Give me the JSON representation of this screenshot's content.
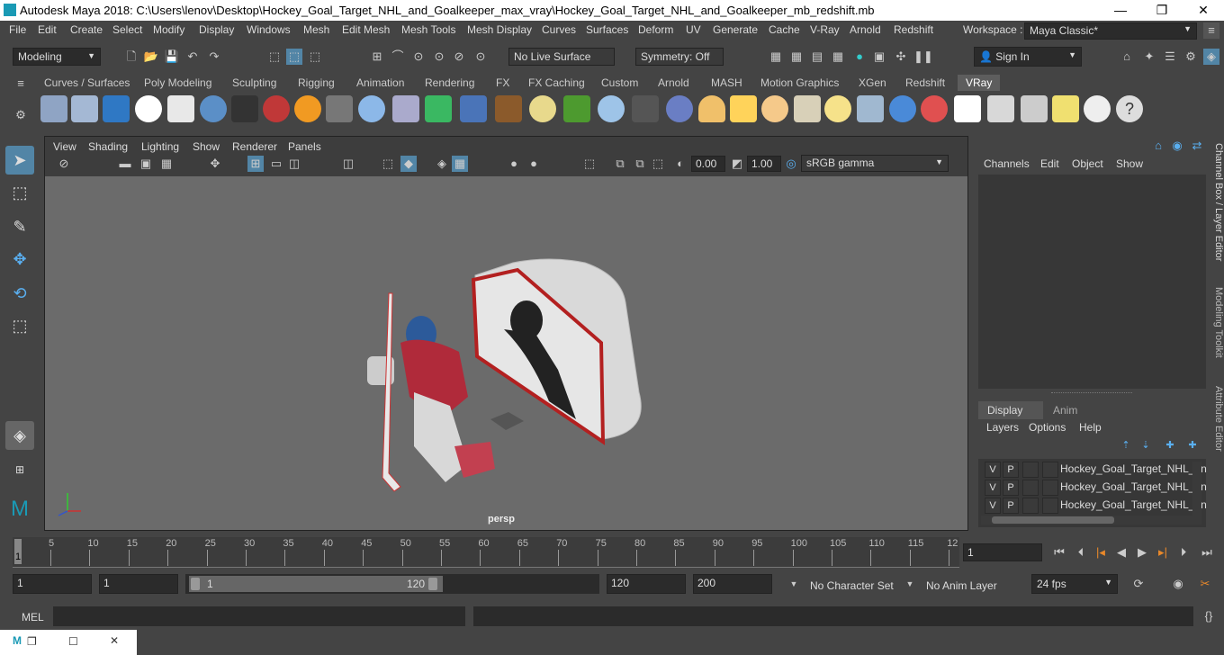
{
  "title": "Autodesk Maya 2018: C:\\Users\\lenov\\Desktop\\Hockey_Goal_Target_NHL_and_Goalkeeper_max_vray\\Hockey_Goal_Target_NHL_and_Goalkeeper_mb_redshift.mb",
  "window_controls": [
    "—",
    "❐",
    "✕"
  ],
  "menus": [
    "File",
    "Edit",
    "Create",
    "Select",
    "Modify",
    "Display",
    "Windows",
    "Mesh",
    "Edit Mesh",
    "Mesh Tools",
    "Mesh Display",
    "Curves",
    "Surfaces",
    "Deform",
    "UV",
    "Generate",
    "Cache",
    "V-Ray",
    "Arnold",
    "Redshift"
  ],
  "workspace": {
    "label": "Workspace :",
    "value": "Maya Classic*"
  },
  "status": {
    "mode": "Modeling",
    "live_surface": "No Live Surface",
    "symmetry": "Symmetry: Off",
    "sign_in": "Sign In"
  },
  "shelf_tabs": [
    "Curves / Surfaces",
    "Poly Modeling",
    "Sculpting",
    "Rigging",
    "Animation",
    "Rendering",
    "FX",
    "FX Caching",
    "Custom",
    "Arnold",
    "MASH",
    "Motion Graphics",
    "XGen",
    "Redshift",
    "VRay"
  ],
  "shelf_active": "VRay",
  "viewport": {
    "menus": [
      "View",
      "Shading",
      "Lighting",
      "Show",
      "Renderer",
      "Panels"
    ],
    "exposure": "0.00",
    "gamma": "1.00",
    "color_space": "sRGB gamma",
    "camera_label": "persp"
  },
  "channel_box": {
    "menus": [
      "Channels",
      "Edit",
      "Object",
      "Show"
    ],
    "tabs": [
      "Display",
      "Anim"
    ],
    "layer_menus": [
      "Layers",
      "Options",
      "Help"
    ],
    "layers": [
      {
        "v": "V",
        "p": "P",
        "name": "Hockey_Goal_Target_NHL_an"
      },
      {
        "v": "V",
        "p": "P",
        "name": "Hockey_Goal_Target_NHL_an"
      },
      {
        "v": "V",
        "p": "P",
        "name": "Hockey_Goal_Target_NHL_an"
      }
    ]
  },
  "side_tabs": [
    "Channel Box / Layer Editor",
    "Modeling Toolkit",
    "Attribute Editor"
  ],
  "timeline": {
    "ticks": [
      "5",
      "10",
      "15",
      "20",
      "25",
      "30",
      "35",
      "40",
      "45",
      "50",
      "55",
      "60",
      "65",
      "70",
      "75",
      "80",
      "85",
      "90",
      "95",
      "100",
      "105",
      "110",
      "115",
      "12"
    ],
    "current_frame_marker": "1",
    "current_frame": "1"
  },
  "range": {
    "start": "1",
    "start_inner": "1",
    "slider_start": "1",
    "slider_end": "120",
    "end_inner": "120",
    "end": "200",
    "character_set": "No Character Set",
    "anim_layer": "No Anim Layer",
    "fps": "24 fps"
  },
  "command_line": {
    "label": "MEL"
  },
  "taskbar": {
    "controls": [
      "❐",
      "☐",
      "✕"
    ]
  }
}
